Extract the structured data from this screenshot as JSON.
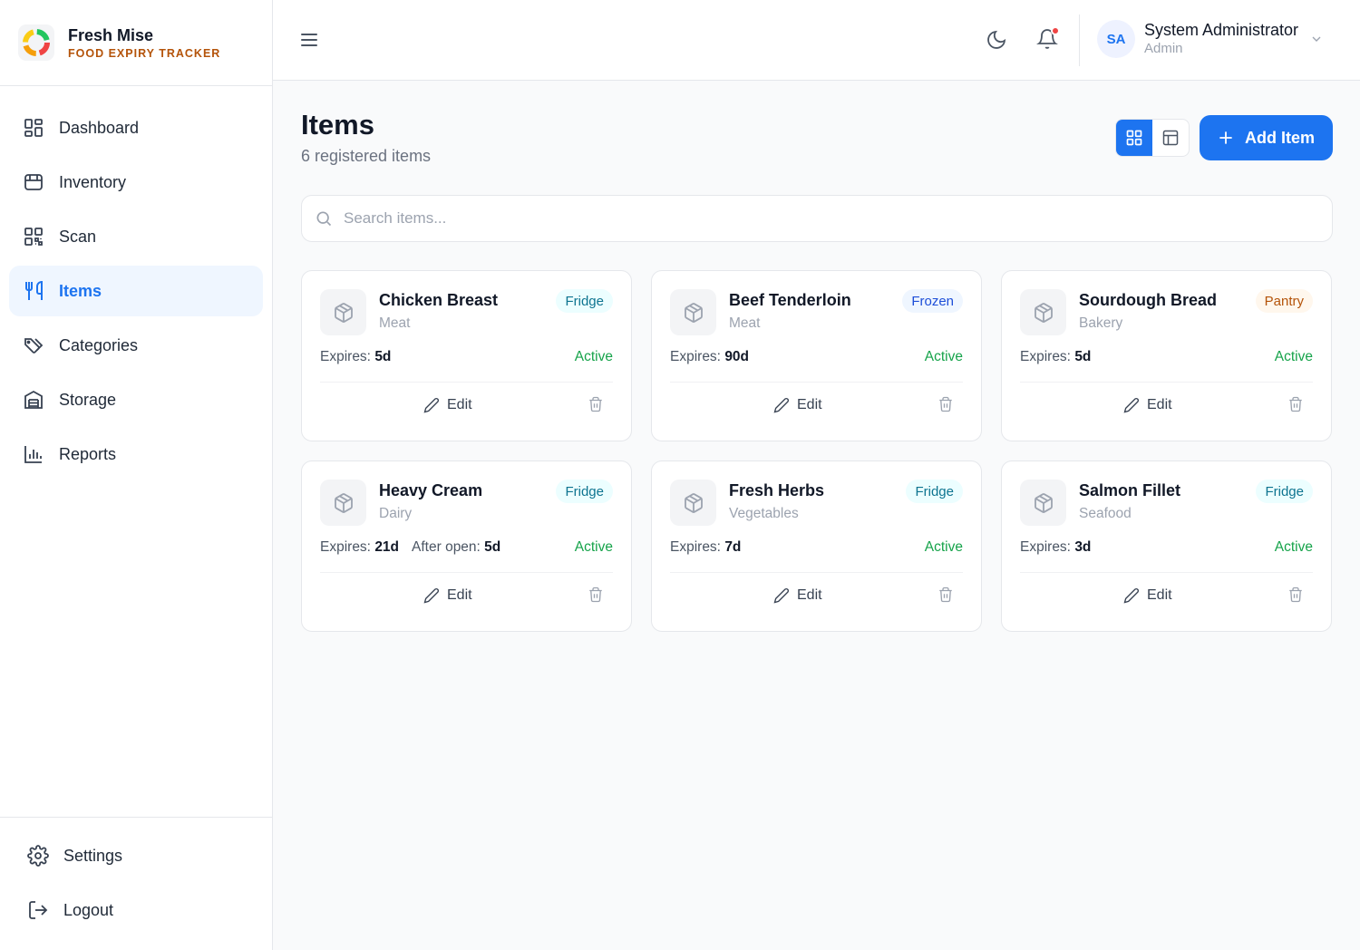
{
  "brand": {
    "name": "Fresh Mise",
    "tagline": "FOOD EXPIRY TRACKER"
  },
  "sidebar": {
    "items": [
      {
        "label": "Dashboard",
        "icon": "dashboard-icon"
      },
      {
        "label": "Inventory",
        "icon": "box-icon"
      },
      {
        "label": "Scan",
        "icon": "qr-code-icon"
      },
      {
        "label": "Items",
        "icon": "utensils-icon",
        "active": true
      },
      {
        "label": "Categories",
        "icon": "tags-icon"
      },
      {
        "label": "Storage",
        "icon": "warehouse-icon"
      },
      {
        "label": "Reports",
        "icon": "bar-chart-icon"
      }
    ],
    "bottom": [
      {
        "label": "Settings",
        "icon": "gear-icon"
      },
      {
        "label": "Logout",
        "icon": "logout-icon"
      }
    ]
  },
  "header": {
    "user": {
      "initials": "SA",
      "name": "System Administrator",
      "role": "Admin"
    },
    "notification_dot": true
  },
  "page": {
    "title": "Items",
    "subtitle": "6 registered items",
    "add_label": "Add Item",
    "search_placeholder": "Search items...",
    "view_mode": "grid"
  },
  "items": [
    {
      "name": "Chicken Breast",
      "category": "Meat",
      "storage": "Fridge",
      "expires_label": "Expires:",
      "expires": "5d",
      "status": "Active"
    },
    {
      "name": "Beef Tenderloin",
      "category": "Meat",
      "storage": "Frozen",
      "expires_label": "Expires:",
      "expires": "90d",
      "status": "Active"
    },
    {
      "name": "Sourdough Bread",
      "category": "Bakery",
      "storage": "Pantry",
      "expires_label": "Expires:",
      "expires": "5d",
      "status": "Active"
    },
    {
      "name": "Heavy Cream",
      "category": "Dairy",
      "storage": "Fridge",
      "expires_label": "Expires:",
      "expires": "21d",
      "after_open_label": "After open:",
      "after_open": "5d",
      "status": "Active"
    },
    {
      "name": "Fresh Herbs",
      "category": "Vegetables",
      "storage": "Fridge",
      "expires_label": "Expires:",
      "expires": "7d",
      "status": "Active"
    },
    {
      "name": "Salmon Fillet",
      "category": "Seafood",
      "storage": "Fridge",
      "expires_label": "Expires:",
      "expires": "3d",
      "status": "Active"
    }
  ],
  "card_actions": {
    "edit_label": "Edit"
  },
  "colors": {
    "accent": "#1d74f0",
    "status_active": "#16a34a",
    "fridge": "#0e7490",
    "frozen": "#1d4ed8",
    "pantry": "#b45309",
    "notification": "#ef4444"
  }
}
